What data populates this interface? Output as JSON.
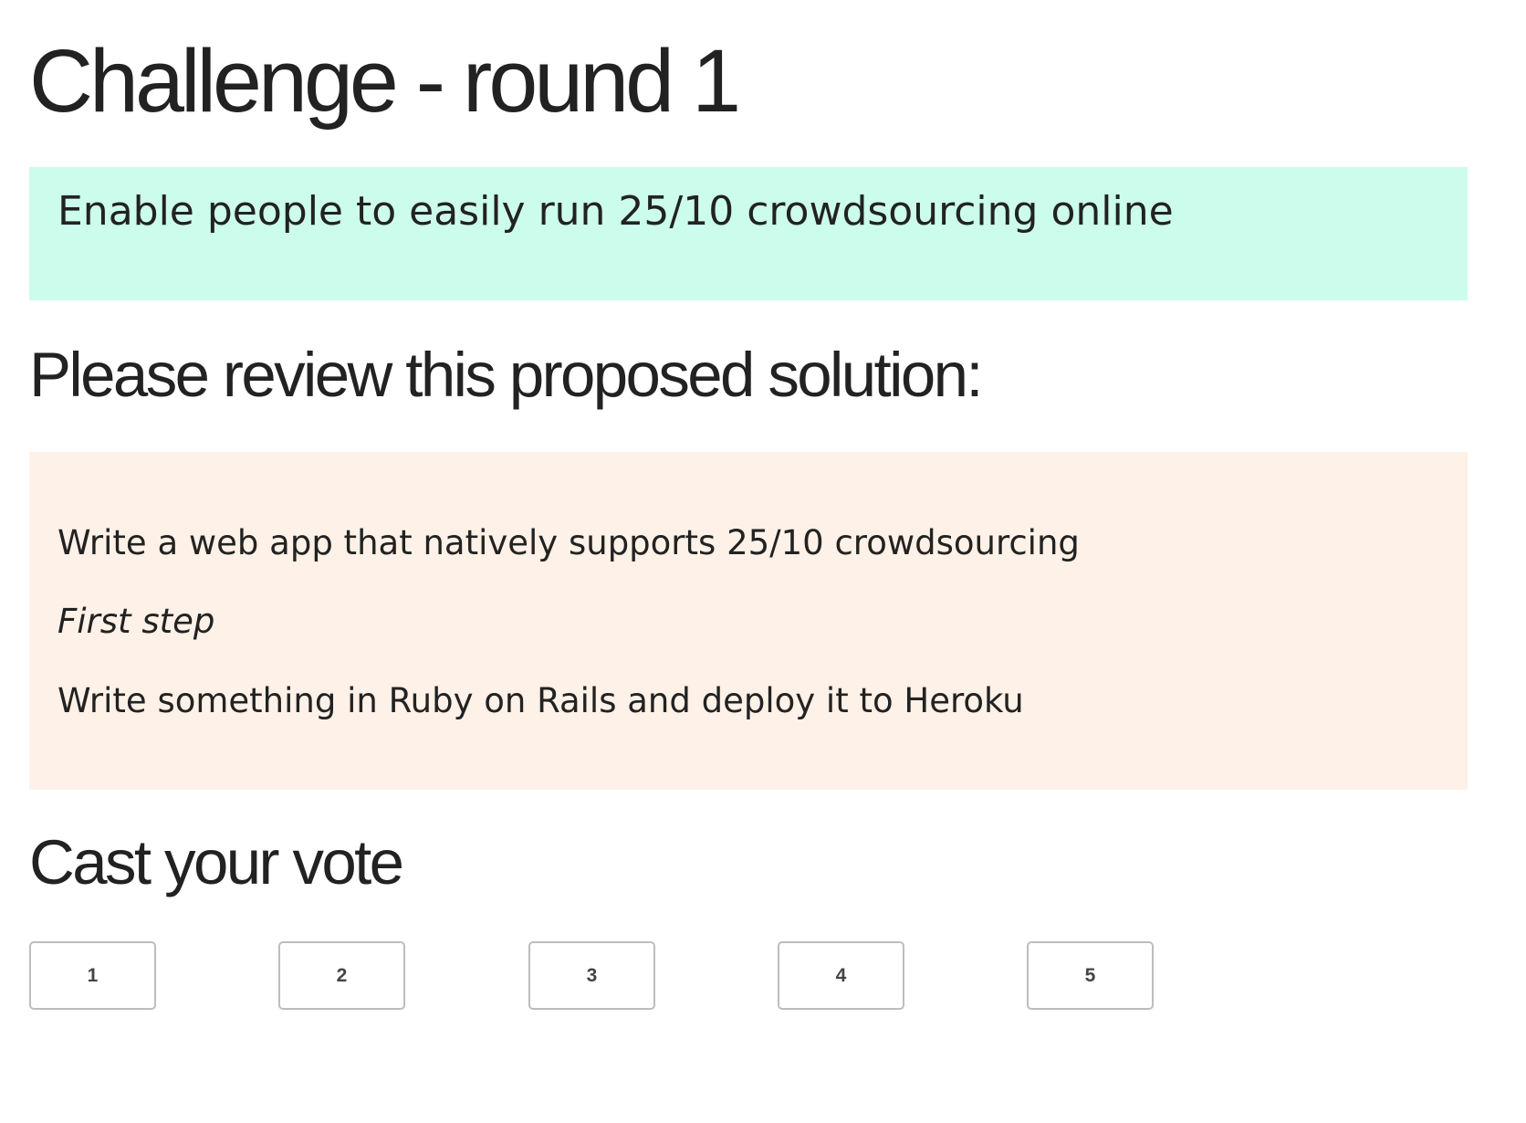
{
  "page": {
    "title": "Challenge - round 1"
  },
  "challenge": {
    "text": "Enable people to easily run 25/10 crowdsourcing online",
    "background_color": "#ccfdec"
  },
  "review": {
    "heading": "Please review this proposed solution:",
    "background_color": "#fef1e7",
    "lines": [
      "Write a web app that natively supports 25/10 crowdsourcing",
      "First step",
      "Write something in Ruby on Rails and deploy it to Heroku"
    ]
  },
  "vote": {
    "heading": "Cast your vote",
    "buttons": [
      "1",
      "2",
      "3",
      "4",
      "5"
    ]
  }
}
